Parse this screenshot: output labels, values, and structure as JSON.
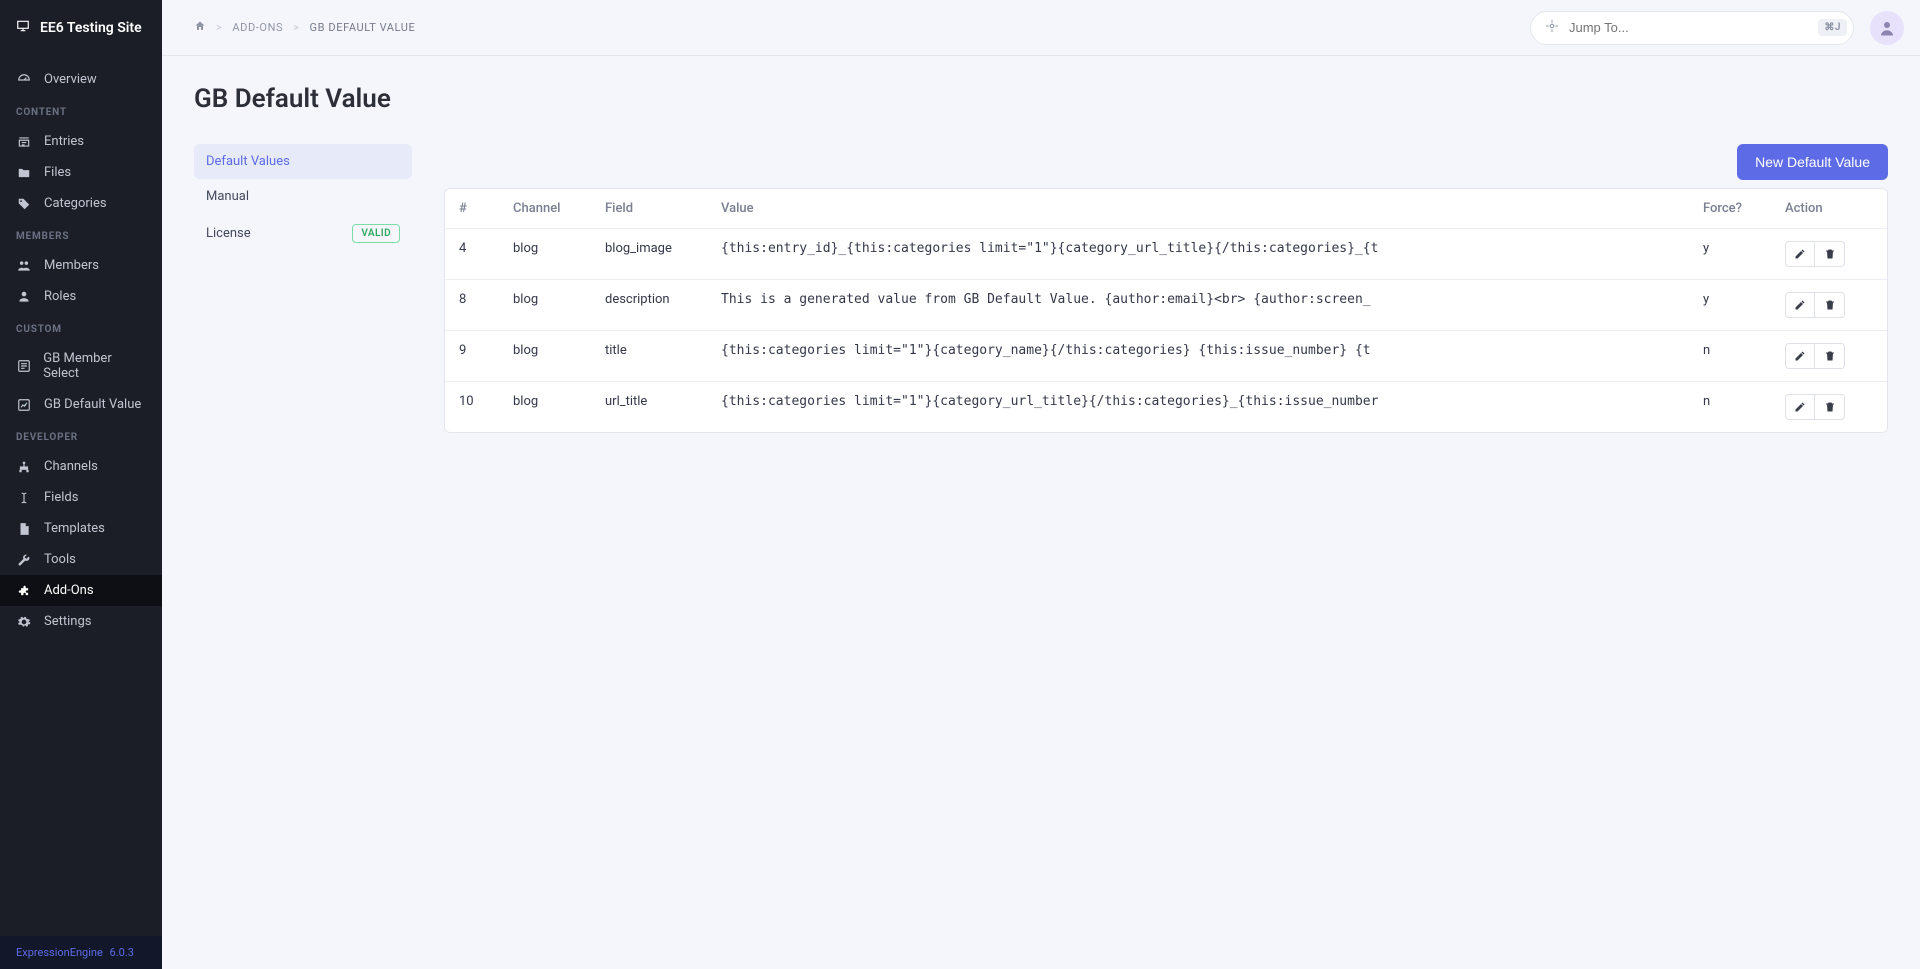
{
  "site_title": "EE6 Testing Site",
  "footer": {
    "product": "ExpressionEngine",
    "version": "6.0.3"
  },
  "sidebar": {
    "overview": "Overview",
    "groups": [
      {
        "header": "CONTENT",
        "items": [
          {
            "label": "Entries",
            "icon": "entries-icon"
          },
          {
            "label": "Files",
            "icon": "folder-icon"
          },
          {
            "label": "Categories",
            "icon": "tag-icon"
          }
        ]
      },
      {
        "header": "MEMBERS",
        "items": [
          {
            "label": "Members",
            "icon": "members-icon"
          },
          {
            "label": "Roles",
            "icon": "user-icon"
          }
        ]
      },
      {
        "header": "CUSTOM",
        "items": [
          {
            "label": "GB Member Select",
            "icon": "select-box-icon",
            "accent": true
          },
          {
            "label": "GB Default Value",
            "icon": "chart-box-icon",
            "accent": true
          }
        ]
      },
      {
        "header": "DEVELOPER",
        "items": [
          {
            "label": "Channels",
            "icon": "sitemap-icon"
          },
          {
            "label": "Fields",
            "icon": "text-cursor-icon"
          },
          {
            "label": "Templates",
            "icon": "file-icon"
          },
          {
            "label": "Tools",
            "icon": "wrench-icon"
          },
          {
            "label": "Add-Ons",
            "icon": "puzzle-icon",
            "active": true
          },
          {
            "label": "Settings",
            "icon": "gear-icon"
          }
        ]
      }
    ]
  },
  "breadcrumbs": [
    {
      "label": "ADD-ONS",
      "current": false
    },
    {
      "label": "GB DEFAULT VALUE",
      "current": true
    }
  ],
  "search": {
    "placeholder": "Jump To...",
    "shortcut": "⌘J"
  },
  "page_title": "GB Default Value",
  "side_tabs": [
    {
      "label": "Default Values",
      "active": true
    },
    {
      "label": "Manual"
    },
    {
      "label": "License",
      "badge": "VALID"
    }
  ],
  "actions": {
    "new_button": "New Default Value"
  },
  "table": {
    "headers": {
      "id": "#",
      "channel": "Channel",
      "field": "Field",
      "value": "Value",
      "force": "Force?",
      "action": "Action"
    },
    "rows": [
      {
        "id": "4",
        "channel": "blog",
        "field": "blog_image",
        "value": "{this:entry_id}_{this:categories limit=\"1\"}{category_url_title}{/this:categories}_{t",
        "force": "y"
      },
      {
        "id": "8",
        "channel": "blog",
        "field": "description",
        "value": "This is a generated value from GB Default Value. {author:email}<br> {author:screen_",
        "force": "y"
      },
      {
        "id": "9",
        "channel": "blog",
        "field": "title",
        "value": "{this:categories limit=\"1\"}{category_name}{/this:categories} {this:issue_number} {t",
        "force": "n"
      },
      {
        "id": "10",
        "channel": "blog",
        "field": "url_title",
        "value": "{this:categories limit=\"1\"}{category_url_title}{/this:categories}_{this:issue_number",
        "force": "n"
      }
    ]
  }
}
